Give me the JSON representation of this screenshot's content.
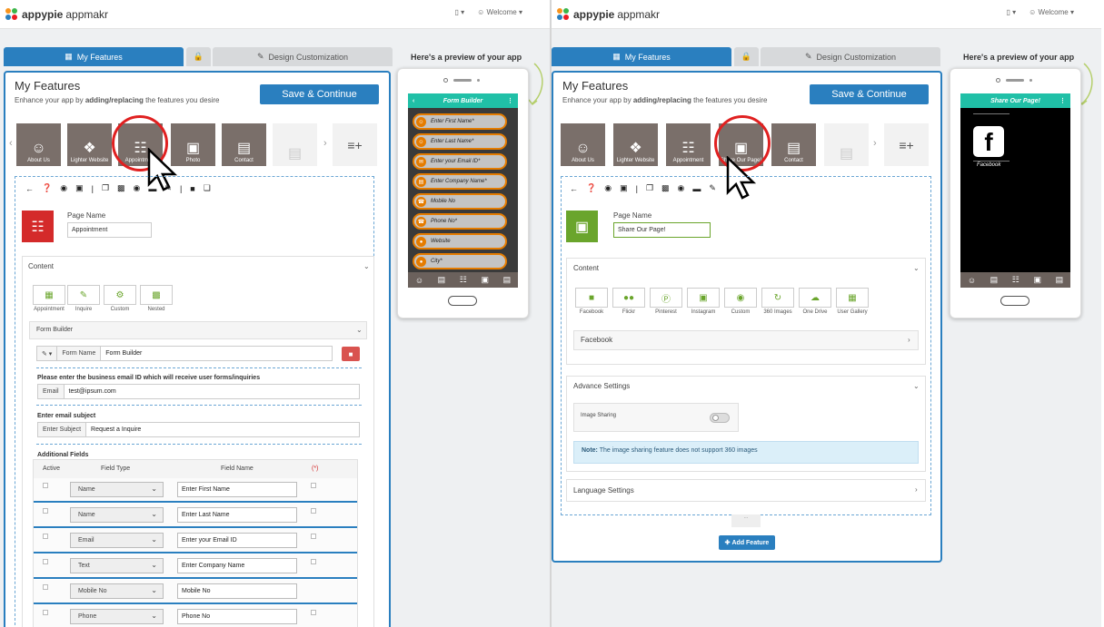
{
  "brand": {
    "name_bold": "appypie",
    "name_rest": "appmakr"
  },
  "topbar": {
    "welcome": "Welcome"
  },
  "tabs": {
    "features": "My Features",
    "design": "Design Customization"
  },
  "preview_label": "Here's a preview of your app",
  "left": {
    "title": "My Features",
    "subtitle_pre": "Enhance your app by ",
    "subtitle_bold": "adding/replacing",
    "subtitle_post": " the features you desire",
    "save_label": "Save & Continue",
    "tiles": [
      {
        "label": "About Us",
        "icon": "person-icon"
      },
      {
        "label": "Lighter Website",
        "icon": "lighter-icon"
      },
      {
        "label": "Appointment",
        "icon": "appointment-icon"
      },
      {
        "label": "Photo",
        "icon": "photo-icon"
      },
      {
        "label": "Contact",
        "icon": "contact-icon"
      }
    ],
    "page_name_label": "Page Name",
    "page_name_value": "Appointment",
    "content_label": "Content",
    "content_tiles": [
      "Appointment",
      "Inquire",
      "Custom",
      "Nested"
    ],
    "form_builder_label": "Form Builder",
    "form_name_label": "Form Name",
    "form_name_value": "Form Builder",
    "email_instruction": "Please enter the business email ID which will receive user forms/inquiries",
    "email_prefix": "Email",
    "email_value": "test@ipsum.com",
    "subject_instruction": "Enter email subject",
    "subject_prefix": "Enter Subject",
    "subject_value": "Request a Inquire",
    "additional_label": "Additional Fields",
    "col_active": "Active",
    "col_type": "Field Type",
    "col_name": "Field Name",
    "col_req": "(*)",
    "fields": [
      {
        "type": "Name",
        "name": "Enter First Name"
      },
      {
        "type": "Name",
        "name": "Enter Last Name"
      },
      {
        "type": "Email",
        "name": "Enter your Email ID"
      },
      {
        "type": "Text",
        "name": "Enter Company Name"
      },
      {
        "type": "Mobile No",
        "name": "Mobile No"
      },
      {
        "type": "Phone",
        "name": "Phone No"
      }
    ],
    "phone_title": "Form Builder",
    "phone_items": [
      "Enter First Name*",
      "Enter Last Name*",
      "Enter your Email ID*",
      "Enter Company Name*",
      "Mobile No",
      "Phone No*",
      "Website",
      "City*"
    ]
  },
  "right": {
    "title": "My Features",
    "subtitle_pre": "Enhance your app by ",
    "subtitle_bold": "adding/replacing",
    "subtitle_post": " the features you desire",
    "save_label": "Save & Continue",
    "tiles": [
      {
        "label": "About Us",
        "icon": "person-icon"
      },
      {
        "label": "Lighter Website",
        "icon": "lighter-icon"
      },
      {
        "label": "Appointment",
        "icon": "appointment-icon"
      },
      {
        "label": "Share Our Page!",
        "icon": "share-page-icon"
      },
      {
        "label": "Contact",
        "icon": "contact-icon"
      }
    ],
    "page_name_label": "Page Name",
    "page_name_value": "Share Our Page!",
    "content_label": "Content",
    "content_tiles": [
      "Facebook",
      "Flickr",
      "Pinterest",
      "Instagram",
      "Custom",
      "360 Images",
      "One Drive",
      "User Gallery"
    ],
    "facebook_row": "Facebook",
    "advance_label": "Advance Settings",
    "image_sharing_label": "Image Sharing",
    "note_bold": "Note:",
    "note_text": " The image sharing feature does not support 360 images",
    "language_label": "Language Settings",
    "more_label": "...",
    "add_feature": "Add Feature",
    "phone_title": "Share Our Page!",
    "phone_caption": "Facebook"
  }
}
